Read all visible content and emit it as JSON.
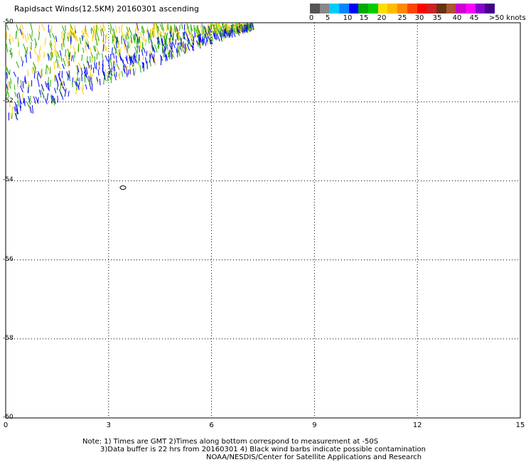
{
  "header": {
    "title": "Rapidsact Winds(12.5KM) 20160301 ascending"
  },
  "colorbar": {
    "swatches": [
      "#555555",
      "#888888",
      "#00ccff",
      "#0088ff",
      "#0000ff",
      "#00aa00",
      "#00cc00",
      "#ffdd00",
      "#ffbb00",
      "#ff8800",
      "#ff4400",
      "#ff0000",
      "#cc2222",
      "#663311",
      "#aa5533",
      "#cc00cc",
      "#ff00ff",
      "#8800cc",
      "#440088"
    ],
    "ticks": [
      "0",
      "5",
      "10",
      "15",
      "20",
      "25",
      "30",
      "35",
      "40",
      "45",
      ">50 knots"
    ]
  },
  "map": {
    "lat_labels": [
      "-50",
      "-52",
      "-54",
      "-56",
      "-58",
      "-60"
    ],
    "lon_labels": [
      "0",
      "3",
      "6",
      "9",
      "12",
      "15"
    ],
    "lat_range": [
      -60,
      -50
    ],
    "lon_range": [
      0,
      15
    ],
    "gridlines": true,
    "contour_label": "0",
    "wind_swath": {
      "lon_range": [
        0,
        7.2
      ],
      "lat_range": [
        -52.4,
        -50
      ],
      "colors": {
        "low": "#0000ff",
        "mid": "#22aa00",
        "high": "#ffcc00",
        "contaminated": "#000000"
      }
    }
  },
  "notes": {
    "line1": "Note: 1) Times are GMT 2)Times along bottom correspond to measurement at -50S",
    "line2": "3)Data buffer is 22 hrs from 20160301 4) Black wind barbs indicate possible contamination",
    "line3": "NOAA/NESDIS/Center for Satellite Applications and Research"
  }
}
